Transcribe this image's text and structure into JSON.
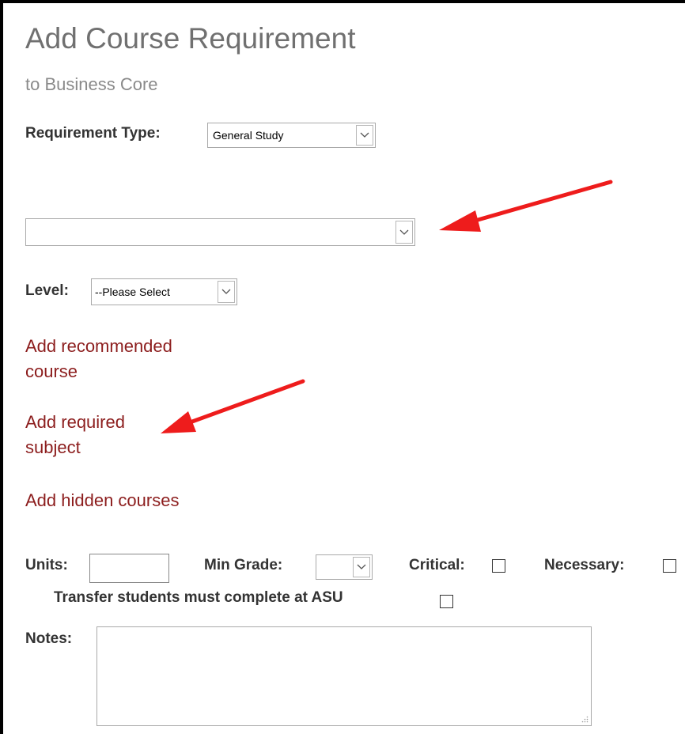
{
  "header": {
    "title": "Add Course Requirement",
    "subtitle": "to Business Core"
  },
  "form": {
    "requirement_type_label": "Requirement Type:",
    "requirement_type_value": "General Study",
    "secondary_select_value": "",
    "level_label": "Level:",
    "level_value": "--Please Select",
    "links": {
      "recommended_line1": "Add recommended",
      "recommended_line2": "course",
      "required_line1": "Add required",
      "required_line2": "subject",
      "hidden": "Add hidden courses"
    },
    "units_label": "Units:",
    "units_value": "",
    "min_grade_label": "Min Grade:",
    "min_grade_value": "",
    "critical_label": "Critical:",
    "critical_checked": false,
    "necessary_label": "Necessary:",
    "necessary_checked": false,
    "transfer_label": "Transfer students must complete at ASU",
    "transfer_checked": false,
    "notes_label": "Notes:",
    "notes_value": ""
  },
  "annotations": {
    "arrow_color": "#ee1c1c"
  }
}
